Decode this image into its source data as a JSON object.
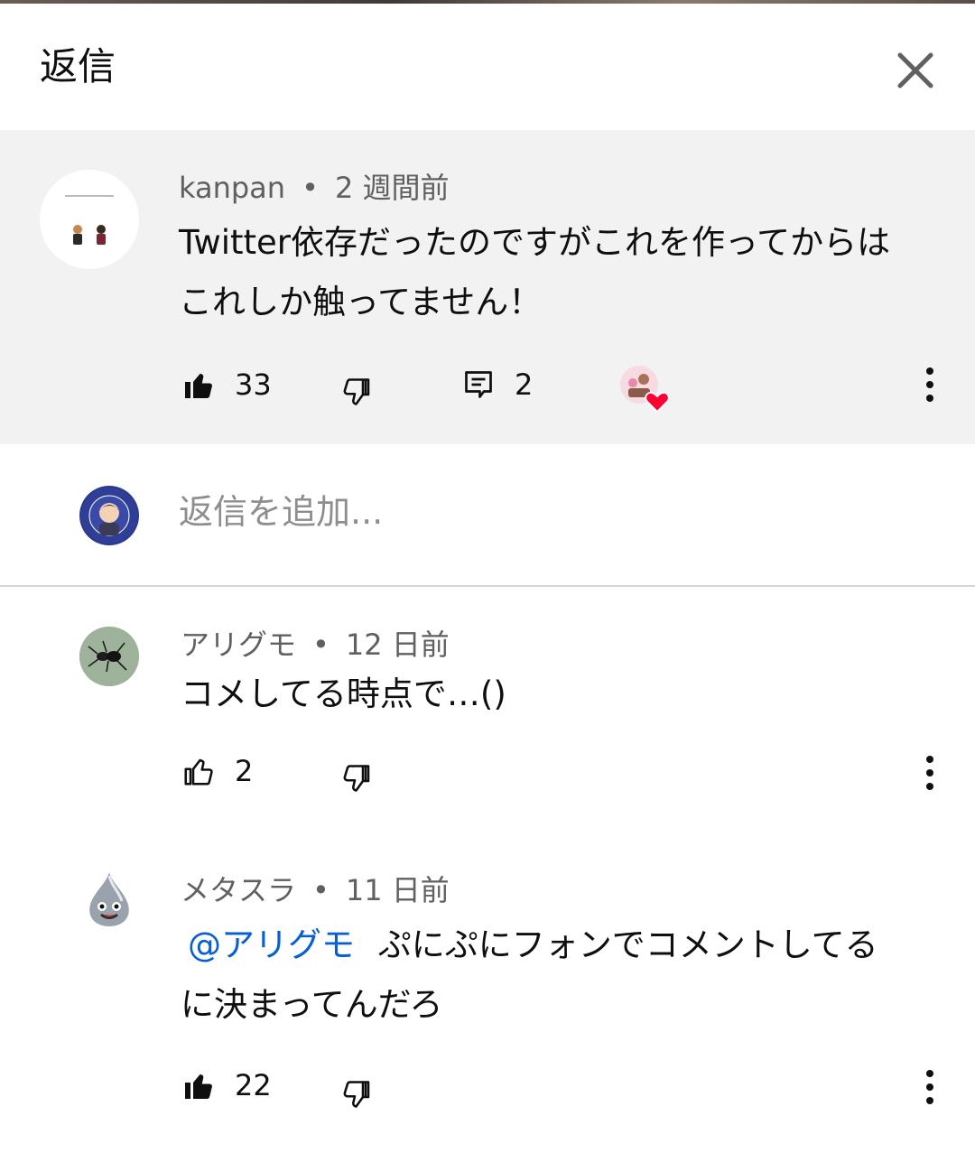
{
  "header": {
    "title": "返信"
  },
  "parent_comment": {
    "author": "kanpan",
    "time": "2 週間前",
    "text_line1": "Twitter依存だったのですがこれを作ってからは",
    "text_line2": "これしか触ってません！",
    "likes": "33",
    "replies": "2",
    "liked": true
  },
  "reply_input": {
    "placeholder": "返信を追加..."
  },
  "replies": [
    {
      "author": "アリグモ",
      "time": "12 日前",
      "text": "コメしてる時点で…()",
      "likes": "2",
      "liked": false
    },
    {
      "author": "メタスラ",
      "time": "11 日前",
      "mention": "@アリグモ",
      "text_line1": "ぷにぷにフォンでコメントしてる",
      "text_line2": "に決まってんだろ",
      "likes": "22",
      "liked": true
    }
  ],
  "meta": {
    "separator": "•"
  }
}
